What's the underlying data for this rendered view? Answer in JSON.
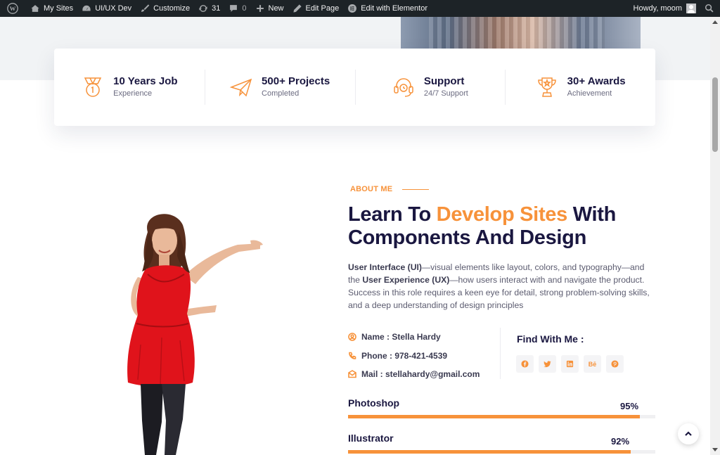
{
  "adminbar": {
    "my_sites": "My Sites",
    "site_name": "UI/UX Dev",
    "customize": "Customize",
    "updates_count": "31",
    "comments_count": "0",
    "new": "New",
    "edit_page": "Edit Page",
    "edit_elementor": "Edit with Elementor",
    "howdy": "Howdy, moom"
  },
  "stats": [
    {
      "title": "10 Years Job",
      "subtitle": "Experience",
      "icon": "medal-icon"
    },
    {
      "title": "500+ Projects",
      "subtitle": "Completed",
      "icon": "paper-plane-icon"
    },
    {
      "title": "Support",
      "subtitle": "24/7 Support",
      "icon": "headset-icon"
    },
    {
      "title": "30+ Awards",
      "subtitle": "Achievement",
      "icon": "trophy-icon"
    }
  ],
  "about": {
    "label": "ABOUT ME",
    "heading_part1": "Learn To ",
    "heading_accent": "Develop Sites",
    "heading_part2": " With Components And Design",
    "para_b1": "User Interface (UI)",
    "para_t1": "—visual elements like layout, colors, and typography—and the ",
    "para_b2": "User Experience (UX)",
    "para_t2": "—how users interact with and navigate the product. Success in this role requires a keen eye for detail, strong problem-solving skills, and a deep understanding of design principles"
  },
  "info": {
    "name": "Name : Stella Hardy",
    "phone": "Phone : 978-421-4539",
    "mail": "Mail : stellahardy@gmail.com"
  },
  "find": {
    "title": "Find With Me :",
    "behance": "Bē"
  },
  "skills": [
    {
      "name": "Photoshop",
      "percent": 95,
      "label": "95%"
    },
    {
      "name": "Illustrator",
      "percent": 92,
      "label": "92%"
    }
  ],
  "colors": {
    "accent": "#f7923a",
    "navy": "#1a1740",
    "adminbar": "#1d2327"
  }
}
